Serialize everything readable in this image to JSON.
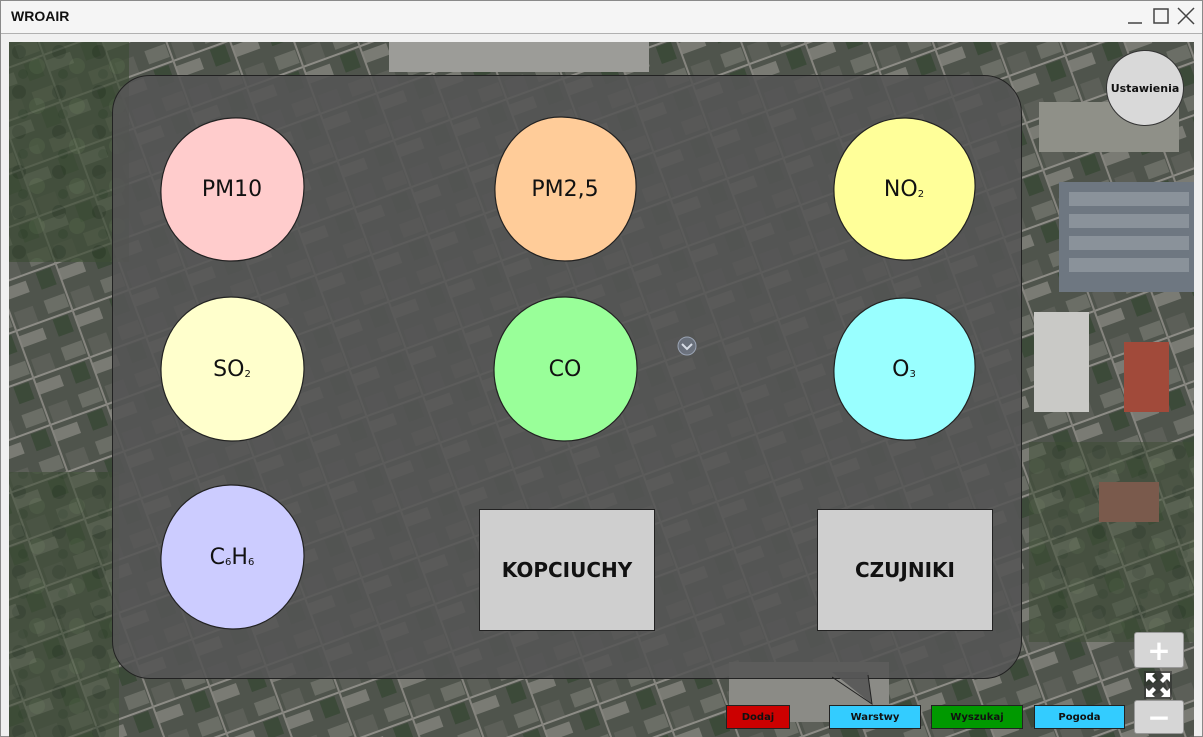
{
  "window": {
    "title": "WROAIR"
  },
  "settings_label": "Ustawienia",
  "pollutants": [
    {
      "label": "PM10",
      "sub": "",
      "color": "#ffcccc"
    },
    {
      "label": "PM2,5",
      "sub": "",
      "color": "#ffcc99"
    },
    {
      "label": "NO",
      "sub": "2",
      "color": "#ffff99"
    },
    {
      "label": "SO",
      "sub": "2",
      "color": "#ffffcc"
    },
    {
      "label": "CO",
      "sub": "",
      "color": "#99ff99"
    },
    {
      "label": "O",
      "sub": "3",
      "color": "#99ffff"
    },
    {
      "label_parts": [
        "C",
        "6",
        "H",
        "6"
      ],
      "color": "#ccccff"
    }
  ],
  "buttons": {
    "kopciuchy": "KOPCIUCHY",
    "czujniki": "CZUJNIKI"
  },
  "bottom_bar": {
    "dodaj": {
      "label": "Dodaj",
      "color": "#cc0000"
    },
    "warstwy": {
      "label": "Warstwy",
      "color": "#33ccff"
    },
    "wyszukaj": {
      "label": "Wyszukaj",
      "color": "#009900"
    },
    "pogoda": {
      "label": "Pogoda",
      "color": "#33ccff"
    }
  },
  "zoom": {
    "in": "+",
    "out": "−"
  },
  "icons": [
    "minimize-icon",
    "maximize-icon",
    "close-icon",
    "fullscreen-icon",
    "map-center-icon"
  ]
}
